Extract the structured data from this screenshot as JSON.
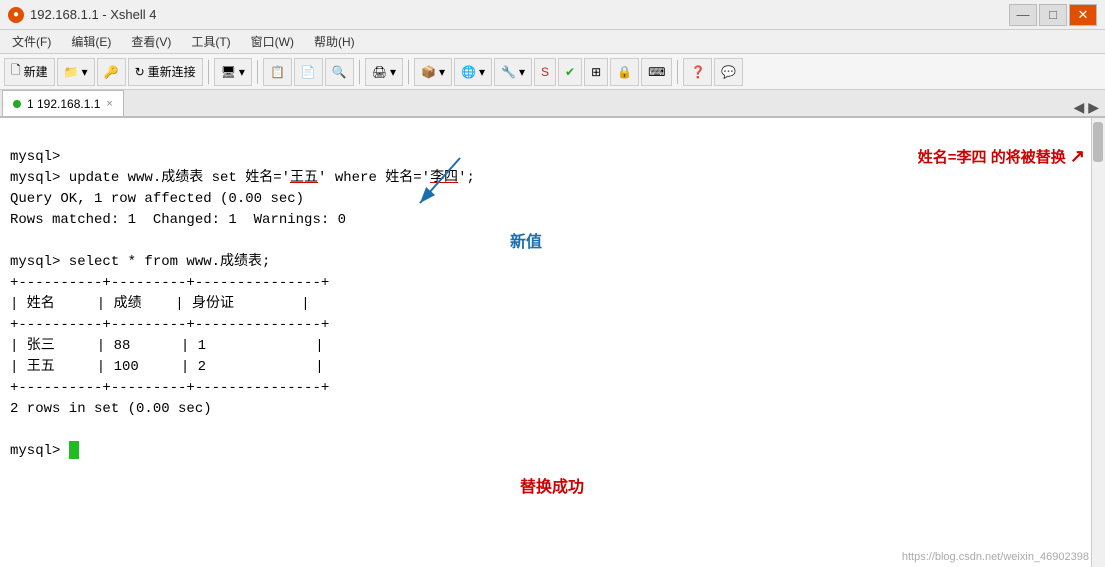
{
  "titlebar": {
    "title": "192.168.1.1 - Xshell 4",
    "icon": "●",
    "btn_min": "—",
    "btn_max": "□",
    "btn_close": "✕"
  },
  "menubar": {
    "items": [
      "文件(F)",
      "编辑(E)",
      "查看(V)",
      "工具(T)",
      "窗口(W)",
      "帮助(H)"
    ]
  },
  "toolbar": {
    "new_label": "新建",
    "reconnect_label": "重新连接"
  },
  "tab": {
    "label": "1 192.168.1.1",
    "close": "×"
  },
  "terminal": {
    "line1": "mysql>",
    "line2_prefix": "mysql> update www.成绩表 set 姓名='",
    "line2_new_val": "王五",
    "line2_mid": "' where 姓名='",
    "line2_old_val": "李四",
    "line2_suffix": "';",
    "line3": "Query OK, 1 row affected (0.00 sec)",
    "line4": "Rows matched: 1  Changed: 1  Warnings: 0",
    "line5": "",
    "line6": "mysql> select * from www.成绩表;",
    "table_border1": "+----------+---------+---------------+",
    "table_header": "| 姓名     | 成绩    | 身份证        |",
    "table_border2": "+----------+---------+---------------+",
    "table_row1": "| 张三     | 88      | 1             |",
    "table_row2": "| 王五     | 100     | 2             |",
    "table_border3": "+----------+---------+---------------+",
    "line7": "2 rows in set (0.00 sec)",
    "line8": "",
    "line9": "mysql> "
  },
  "annotations": {
    "right_label": "姓名=李四 的将被替换",
    "arrow_label": "新值",
    "success_label": "替换成功"
  },
  "watermark": "https://blog.csdn.net/weixin_46902398"
}
